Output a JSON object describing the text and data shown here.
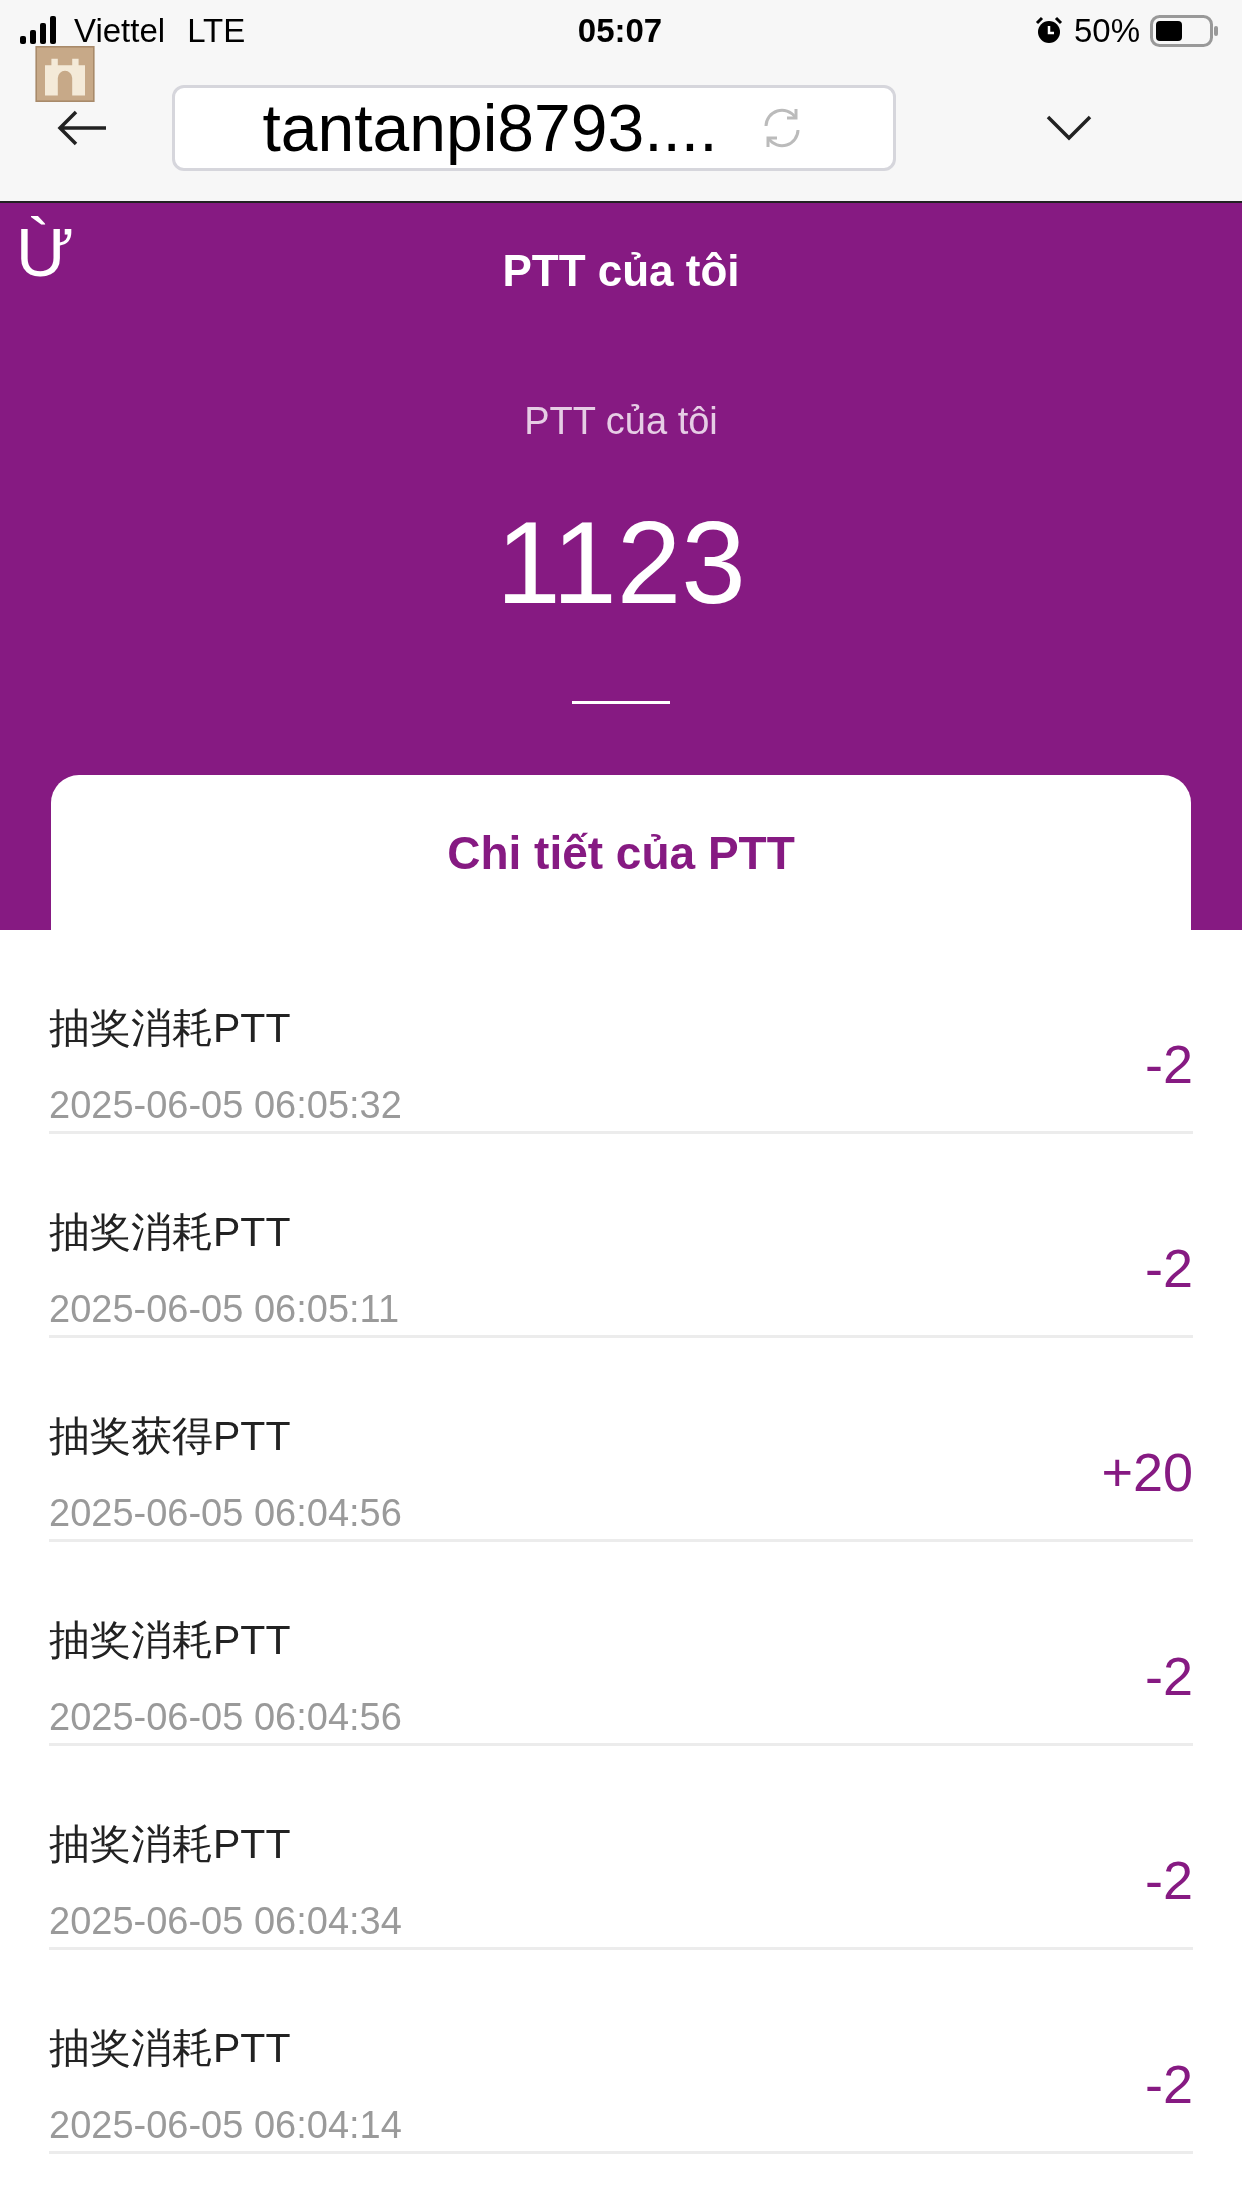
{
  "status_bar": {
    "carrier": "Viettel",
    "network": "LTE",
    "time": "05:07",
    "battery": "50%"
  },
  "browser_bar": {
    "url": "tantanpi8793...."
  },
  "header": {
    "back_glyph": "Ừ",
    "title": "PTT của tôi",
    "balance_label": "PTT của tôi",
    "balance": "1123"
  },
  "details_tab": {
    "label": "Chi tiết của PTT"
  },
  "records": [
    {
      "title": "抽奖消耗PTT",
      "time": "2025-06-05 06:05:32",
      "amount": "-2"
    },
    {
      "title": "抽奖消耗PTT",
      "time": "2025-06-05 06:05:11",
      "amount": "-2"
    },
    {
      "title": "抽奖获得PTT",
      "time": "2025-06-05 06:04:56",
      "amount": "+20"
    },
    {
      "title": "抽奖消耗PTT",
      "time": "2025-06-05 06:04:56",
      "amount": "-2"
    },
    {
      "title": "抽奖消耗PTT",
      "time": "2025-06-05 06:04:34",
      "amount": "-2"
    },
    {
      "title": "抽奖消耗PTT",
      "time": "2025-06-05 06:04:14",
      "amount": "-2"
    }
  ]
}
